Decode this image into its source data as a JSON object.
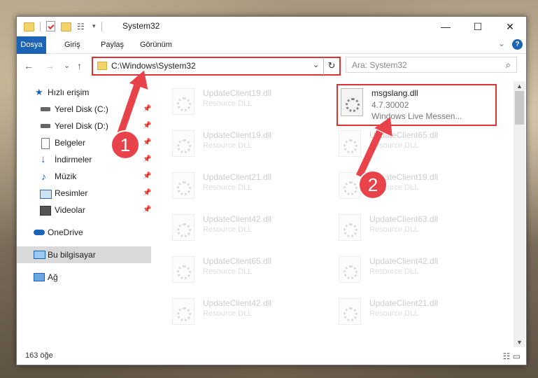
{
  "window": {
    "title": "System32"
  },
  "controls": {
    "minimize": "—",
    "maximize": "☐",
    "close": "✕"
  },
  "ribbon": {
    "tabs": [
      "Dosya",
      "Giriş",
      "Paylaş",
      "Görünüm"
    ],
    "chevron": "⌄",
    "help": "?"
  },
  "nav": {
    "back": "←",
    "forward": "→",
    "recent": "⌄",
    "up": "↑"
  },
  "address": {
    "path": "C:\\Windows\\System32",
    "dropdown": "⌄",
    "refresh": "↻"
  },
  "search": {
    "placeholder": "Ara: System32",
    "icon": "⌕"
  },
  "sidebar": {
    "items": [
      {
        "label": "Hızlı erişim",
        "icon": "star-icon",
        "pinned": false
      },
      {
        "label": "Yerel Disk (C:)",
        "icon": "drive-icon",
        "pinned": true
      },
      {
        "label": "Yerel Disk (D:)",
        "icon": "drive-icon",
        "pinned": true
      },
      {
        "label": "Belgeler",
        "icon": "document-icon",
        "pinned": true
      },
      {
        "label": "İndirmeler",
        "icon": "download-icon",
        "pinned": true
      },
      {
        "label": "Müzik",
        "icon": "music-icon",
        "pinned": true
      },
      {
        "label": "Resimler",
        "icon": "pictures-icon",
        "pinned": true
      },
      {
        "label": "Videolar",
        "icon": "video-icon",
        "pinned": true
      },
      {
        "label": "OneDrive",
        "icon": "cloud-icon",
        "pinned": false
      },
      {
        "label": "Bu bilgisayar",
        "icon": "computer-icon",
        "pinned": false
      },
      {
        "label": "Ağ",
        "icon": "network-icon",
        "pinned": false
      }
    ]
  },
  "files_left": [
    {
      "name": "UpdateClient19.dll",
      "type": "Resource DLL"
    },
    {
      "name": "UpdateClient19.dll",
      "type": "Resource DLL"
    },
    {
      "name": "UpdateClient21.dll",
      "type": "Resource DLL"
    },
    {
      "name": "UpdateClient42.dll",
      "type": "Resource DLL"
    },
    {
      "name": "UpdateClient65.dll",
      "type": "Resource DLL"
    },
    {
      "name": "UpdateClient42.dll",
      "type": "Resource DLL"
    }
  ],
  "files_right": [
    {
      "name": "UpdateClient65.dll",
      "type": "Resource DLL"
    },
    {
      "name": "UpdateClient19.dll",
      "type": "Resource DLL"
    },
    {
      "name": "UpdateClient63.dll",
      "type": "Resource DLL"
    },
    {
      "name": "UpdateClient42.dll",
      "type": "Resource DLL"
    },
    {
      "name": "UpdateClient21.dll",
      "type": "Resource DLL"
    }
  ],
  "highlighted_file": {
    "name": "msgslang.dll",
    "version": "4.7.30002",
    "description": "Windows Live Messen..."
  },
  "annotations": {
    "step1": "1",
    "step2": "2"
  },
  "status": {
    "count": "163 öğe"
  },
  "colors": {
    "accent": "#1a63b5",
    "annotation": "#e8434a"
  }
}
